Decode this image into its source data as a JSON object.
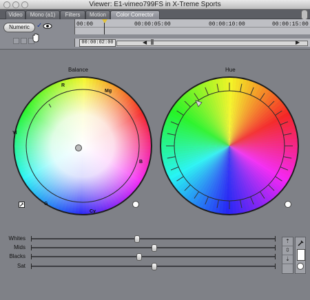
{
  "window": {
    "title": "Viewer: E1-vimeo799FS in X-Treme Sports"
  },
  "tabs": [
    {
      "label": "Video"
    },
    {
      "label": "Mono (a1)"
    },
    {
      "label": "Filters"
    },
    {
      "label": "Motion"
    },
    {
      "label": "Color Corrector"
    }
  ],
  "toolbar": {
    "numeric_label": "Numeric",
    "check_symbol": "✓",
    "timecodes": [
      "00:00",
      "00:00:05:00",
      "00:00:10:00",
      "00:00:15:00"
    ],
    "current_timecode": "00:00:02:00"
  },
  "balance": {
    "title": "Balance",
    "labels": {
      "r": "R",
      "mg": "Mg",
      "yl": "Yl",
      "b": "B",
      "g": "G",
      "cy": "Cy"
    }
  },
  "hue": {
    "title": "Hue"
  },
  "sliders": [
    {
      "label": "Whites",
      "value": 0.43
    },
    {
      "label": "Mids",
      "value": 0.5
    },
    {
      "label": "Blacks",
      "value": 0.44
    },
    {
      "label": "Sat",
      "value": 0.5
    }
  ],
  "icons": {
    "eye": "eye-icon",
    "hand": "hand-icon",
    "eyedropper": "eyedropper-icon",
    "arrow_up": "arrow-up-icon",
    "arrow_down": "arrow-down-icon"
  },
  "colors": {
    "accent": "#e3c33b"
  }
}
